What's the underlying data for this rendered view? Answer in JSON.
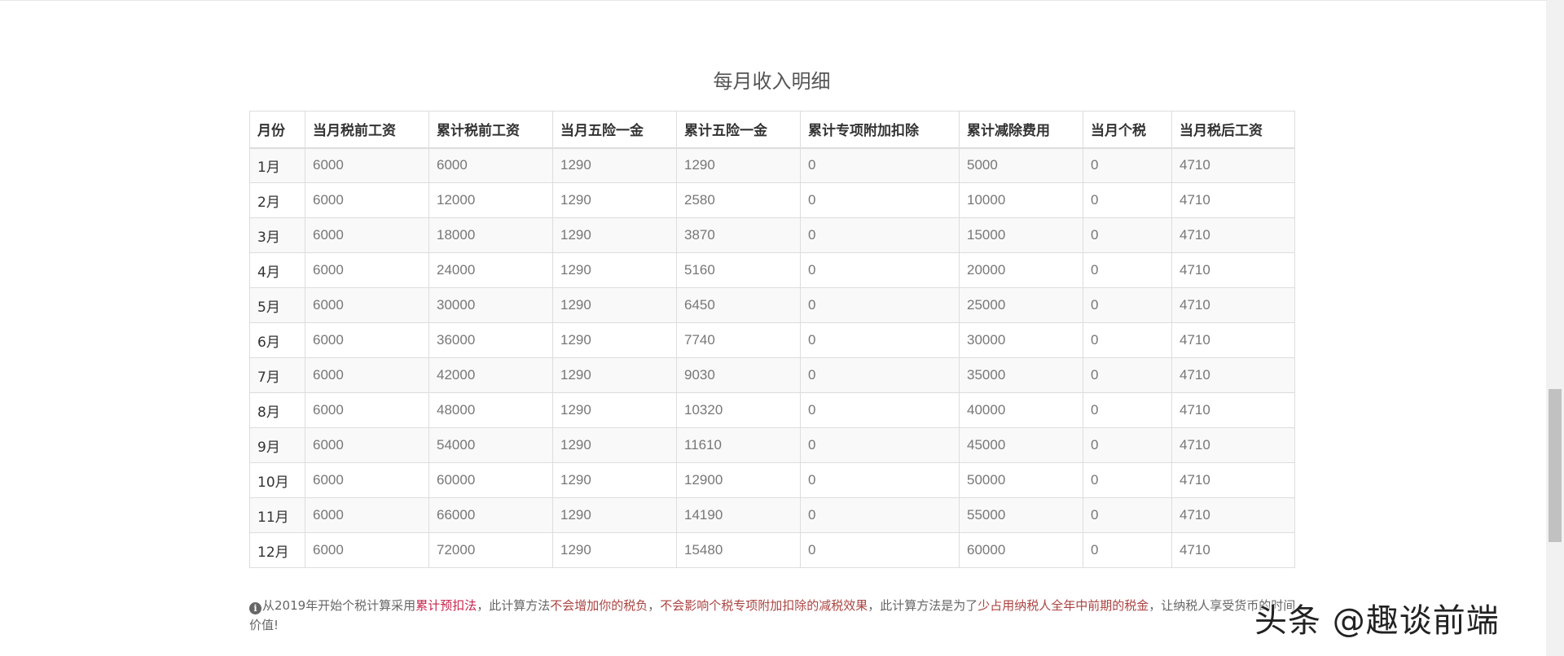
{
  "title": "每月收入明细",
  "table": {
    "headers": [
      "月份",
      "当月税前工资",
      "累计税前工资",
      "当月五险一金",
      "累计五险一金",
      "累计专项附加扣除",
      "累计减除费用",
      "当月个税",
      "当月税后工资"
    ],
    "rows": [
      [
        "1月",
        "6000",
        "6000",
        "1290",
        "1290",
        "0",
        "5000",
        "0",
        "4710"
      ],
      [
        "2月",
        "6000",
        "12000",
        "1290",
        "2580",
        "0",
        "10000",
        "0",
        "4710"
      ],
      [
        "3月",
        "6000",
        "18000",
        "1290",
        "3870",
        "0",
        "15000",
        "0",
        "4710"
      ],
      [
        "4月",
        "6000",
        "24000",
        "1290",
        "5160",
        "0",
        "20000",
        "0",
        "4710"
      ],
      [
        "5月",
        "6000",
        "30000",
        "1290",
        "6450",
        "0",
        "25000",
        "0",
        "4710"
      ],
      [
        "6月",
        "6000",
        "36000",
        "1290",
        "7740",
        "0",
        "30000",
        "0",
        "4710"
      ],
      [
        "7月",
        "6000",
        "42000",
        "1290",
        "9030",
        "0",
        "35000",
        "0",
        "4710"
      ],
      [
        "8月",
        "6000",
        "48000",
        "1290",
        "10320",
        "0",
        "40000",
        "0",
        "4710"
      ],
      [
        "9月",
        "6000",
        "54000",
        "1290",
        "11610",
        "0",
        "45000",
        "0",
        "4710"
      ],
      [
        "10月",
        "6000",
        "60000",
        "1290",
        "12900",
        "0",
        "50000",
        "0",
        "4710"
      ],
      [
        "11月",
        "6000",
        "66000",
        "1290",
        "14190",
        "0",
        "55000",
        "0",
        "4710"
      ],
      [
        "12月",
        "6000",
        "72000",
        "1290",
        "15480",
        "0",
        "60000",
        "0",
        "4710"
      ]
    ]
  },
  "note": {
    "icon": "info-circle-icon",
    "icon_glyph": "i",
    "part1": "从2019年开始个税计算采用",
    "link": "累计预扣法",
    "part2": "，此计算方法",
    "hl1": "不会增加你的税负",
    "part3": "，",
    "hl2": "不会影响个税专项附加扣除的减税效果",
    "part4": "，此计算方法是为了",
    "hl3": "少占用纳税人全年中前期的税金",
    "part5": "，让纳税人享受货币的时间价值!"
  },
  "watermark": "头条 @趣谈前端",
  "colors": {
    "link": "#c7254e",
    "highlight": "#a94442",
    "stripe": "#f9f9f9",
    "border": "#dddddd"
  }
}
